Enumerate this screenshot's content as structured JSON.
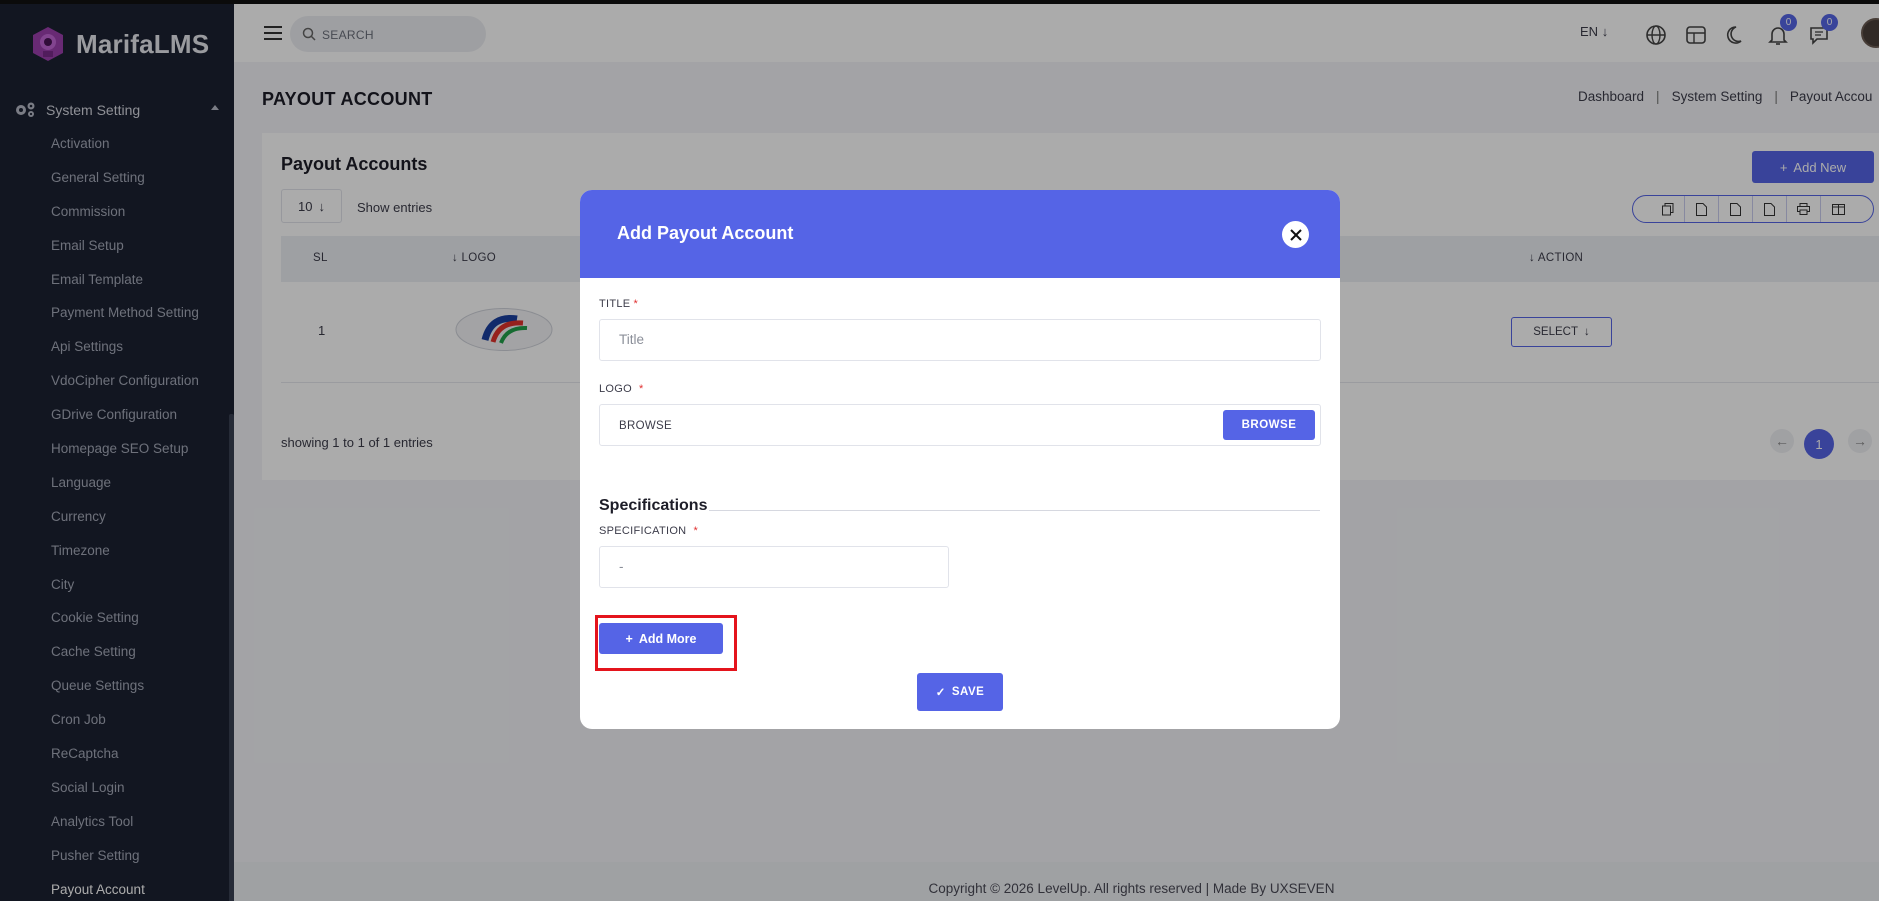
{
  "app": {
    "brand": "MarifaLMS"
  },
  "sidebar": {
    "section_label": "System Setting",
    "items": [
      {
        "label": "Activation"
      },
      {
        "label": "General Setting"
      },
      {
        "label": "Commission"
      },
      {
        "label": "Email Setup"
      },
      {
        "label": "Email Template"
      },
      {
        "label": "Payment Method Setting"
      },
      {
        "label": "Api Settings"
      },
      {
        "label": "VdoCipher Configuration"
      },
      {
        "label": "GDrive Configuration"
      },
      {
        "label": "Homepage SEO Setup"
      },
      {
        "label": "Language"
      },
      {
        "label": "Currency"
      },
      {
        "label": "Timezone"
      },
      {
        "label": "City"
      },
      {
        "label": "Cookie Setting"
      },
      {
        "label": "Cache Setting"
      },
      {
        "label": "Queue Settings"
      },
      {
        "label": "Cron Job"
      },
      {
        "label": "ReCaptcha"
      },
      {
        "label": "Social Login"
      },
      {
        "label": "Analytics Tool"
      },
      {
        "label": "Pusher Setting"
      },
      {
        "label": "Payout Account",
        "active": true
      }
    ]
  },
  "topbar": {
    "search_placeholder": "SEARCH",
    "language": "EN",
    "notifications_count": "0",
    "messages_count": "0"
  },
  "page": {
    "title": "PAYOUT ACCOUNT",
    "breadcrumb": [
      "Dashboard",
      "System Setting",
      "Payout Accou"
    ]
  },
  "card": {
    "title": "Payout Accounts",
    "add_new_label": "Add New",
    "entries_value": "10",
    "entries_label": "Show entries",
    "columns": {
      "sl": "SL",
      "logo": "LOGO",
      "action": "ACTION"
    },
    "rows": [
      {
        "sl": "1",
        "action_label": "SELECT"
      }
    ],
    "showing_text": "showing 1 to 1 of 1 entries",
    "current_page": "1"
  },
  "modal": {
    "title": "Add Payout Account",
    "title_label": "TITLE",
    "title_placeholder": "Title",
    "logo_label": "LOGO",
    "logo_value": "BROWSE",
    "browse_label": "BROWSE",
    "specifications_heading": "Specifications",
    "specification_label": "SPECIFICATION",
    "specification_placeholder": "-",
    "add_more_label": "Add More",
    "save_label": "SAVE"
  },
  "footer": {
    "text": "Copyright © 2026 LevelUp. All rights reserved | Made By UXSEVEN"
  },
  "colors": {
    "primary": "#5564e6",
    "sidebar_bg": "#1c2232",
    "highlight": "#e4141c"
  }
}
